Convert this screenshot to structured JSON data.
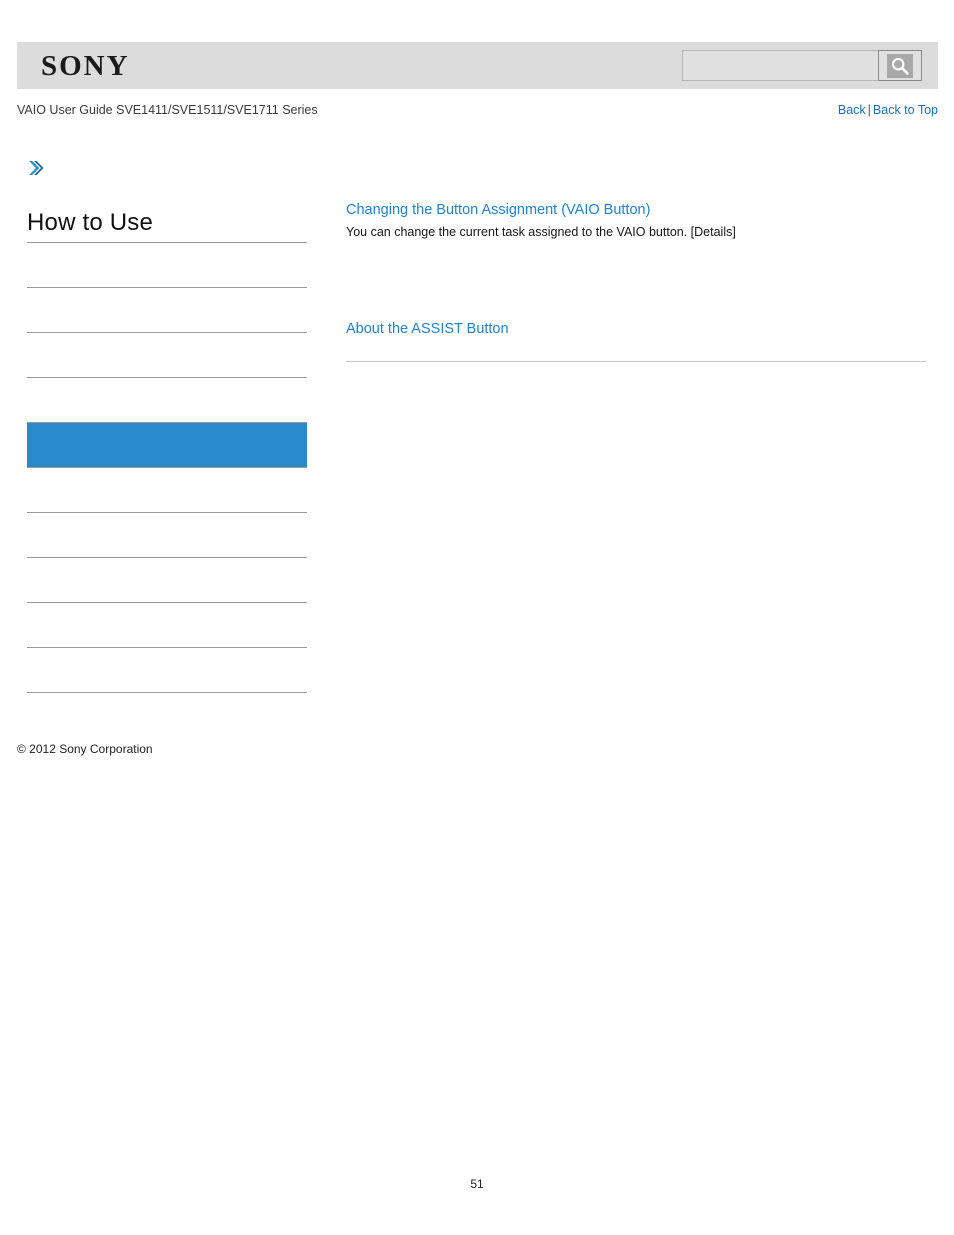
{
  "header": {
    "logo": "SONY",
    "search": {
      "value": "",
      "placeholder": "",
      "button_icon": "search-icon"
    }
  },
  "titlebar": {
    "guide_title": "VAIO User Guide SVE1411/SVE1511/SVE1711 Series",
    "back_label": "Back",
    "separator": "|",
    "back_to_top_label": "Back to Top"
  },
  "sidebar": {
    "breadcrumb_icon": "chevron-right-icon",
    "heading": "How to Use",
    "items": [
      {
        "label": "",
        "selected": false
      },
      {
        "label": "",
        "selected": false
      },
      {
        "label": "",
        "selected": false
      },
      {
        "label": "",
        "selected": false
      },
      {
        "label": "",
        "selected": true
      },
      {
        "label": "",
        "selected": false
      },
      {
        "label": "",
        "selected": false
      },
      {
        "label": "",
        "selected": false
      },
      {
        "label": "",
        "selected": false
      },
      {
        "label": "",
        "selected": false
      }
    ]
  },
  "content": {
    "topics": [
      {
        "link": "Changing the Button Assignment (VAIO Button)",
        "description": "You can change the current task assigned to the VAIO button. [Details]"
      },
      {
        "link": "About the ASSIST Button",
        "description": ""
      }
    ]
  },
  "footer": {
    "copyright": "© 2012 Sony Corporation",
    "page_number": "51"
  },
  "colors": {
    "link": "#1f82d6",
    "nav_link": "#1670c9",
    "selected_bg": "#2a8bcb",
    "header_band": "#dcdcdc",
    "rule": "#9a9a9a"
  }
}
